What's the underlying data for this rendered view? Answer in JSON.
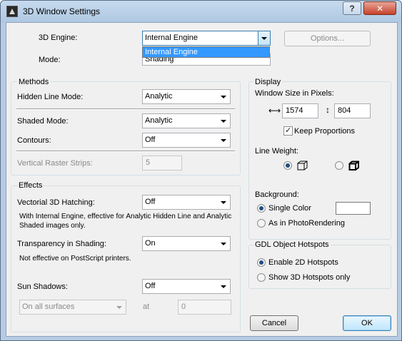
{
  "window": {
    "title": "3D Window Settings"
  },
  "engine": {
    "label": "3D Engine:",
    "value": "Internal Engine",
    "dropdown_option": "Internal Engine",
    "options_button": "Options..."
  },
  "mode": {
    "label": "Mode:",
    "value": "Shading"
  },
  "methods": {
    "title": "Methods",
    "hidden_line_label": "Hidden Line Mode:",
    "hidden_line_value": "Analytic",
    "shaded_label": "Shaded Mode:",
    "shaded_value": "Analytic",
    "contours_label": "Contours:",
    "contours_value": "Off",
    "raster_label": "Vertical Raster Strips:",
    "raster_value": "5"
  },
  "effects": {
    "title": "Effects",
    "hatching_label": "Vectorial 3D Hatching:",
    "hatching_value": "Off",
    "hatching_note": "With Internal Engine, effective for Analytic Hidden Line and Analytic Shaded images only.",
    "transparency_label": "Transparency in Shading:",
    "transparency_value": "On",
    "transparency_note": "Not effective on PostScript printers.",
    "sun_label": "Sun Shadows:",
    "sun_value": "Off",
    "surfaces_value": "On all surfaces",
    "at_label": "at",
    "at_value": "0"
  },
  "display": {
    "title": "Display",
    "window_size_label": "Window Size in Pixels:",
    "width_value": "1574",
    "height_value": "804",
    "keep_proportions": "Keep Proportions",
    "keep_proportions_checked": true,
    "line_weight_label": "Line Weight:",
    "background_label": "Background:",
    "single_color": "Single Color",
    "as_in_photo": "As in PhotoRendering"
  },
  "gdl": {
    "title": "GDL Object Hotspots",
    "enable_2d": "Enable 2D Hotspots",
    "show_3d": "Show 3D Hotspots only"
  },
  "buttons": {
    "cancel": "Cancel",
    "ok": "OK",
    "help": "?"
  },
  "colors": {
    "accent": "#3399ff",
    "close": "#c6422b",
    "frame": "#b5cce4"
  }
}
